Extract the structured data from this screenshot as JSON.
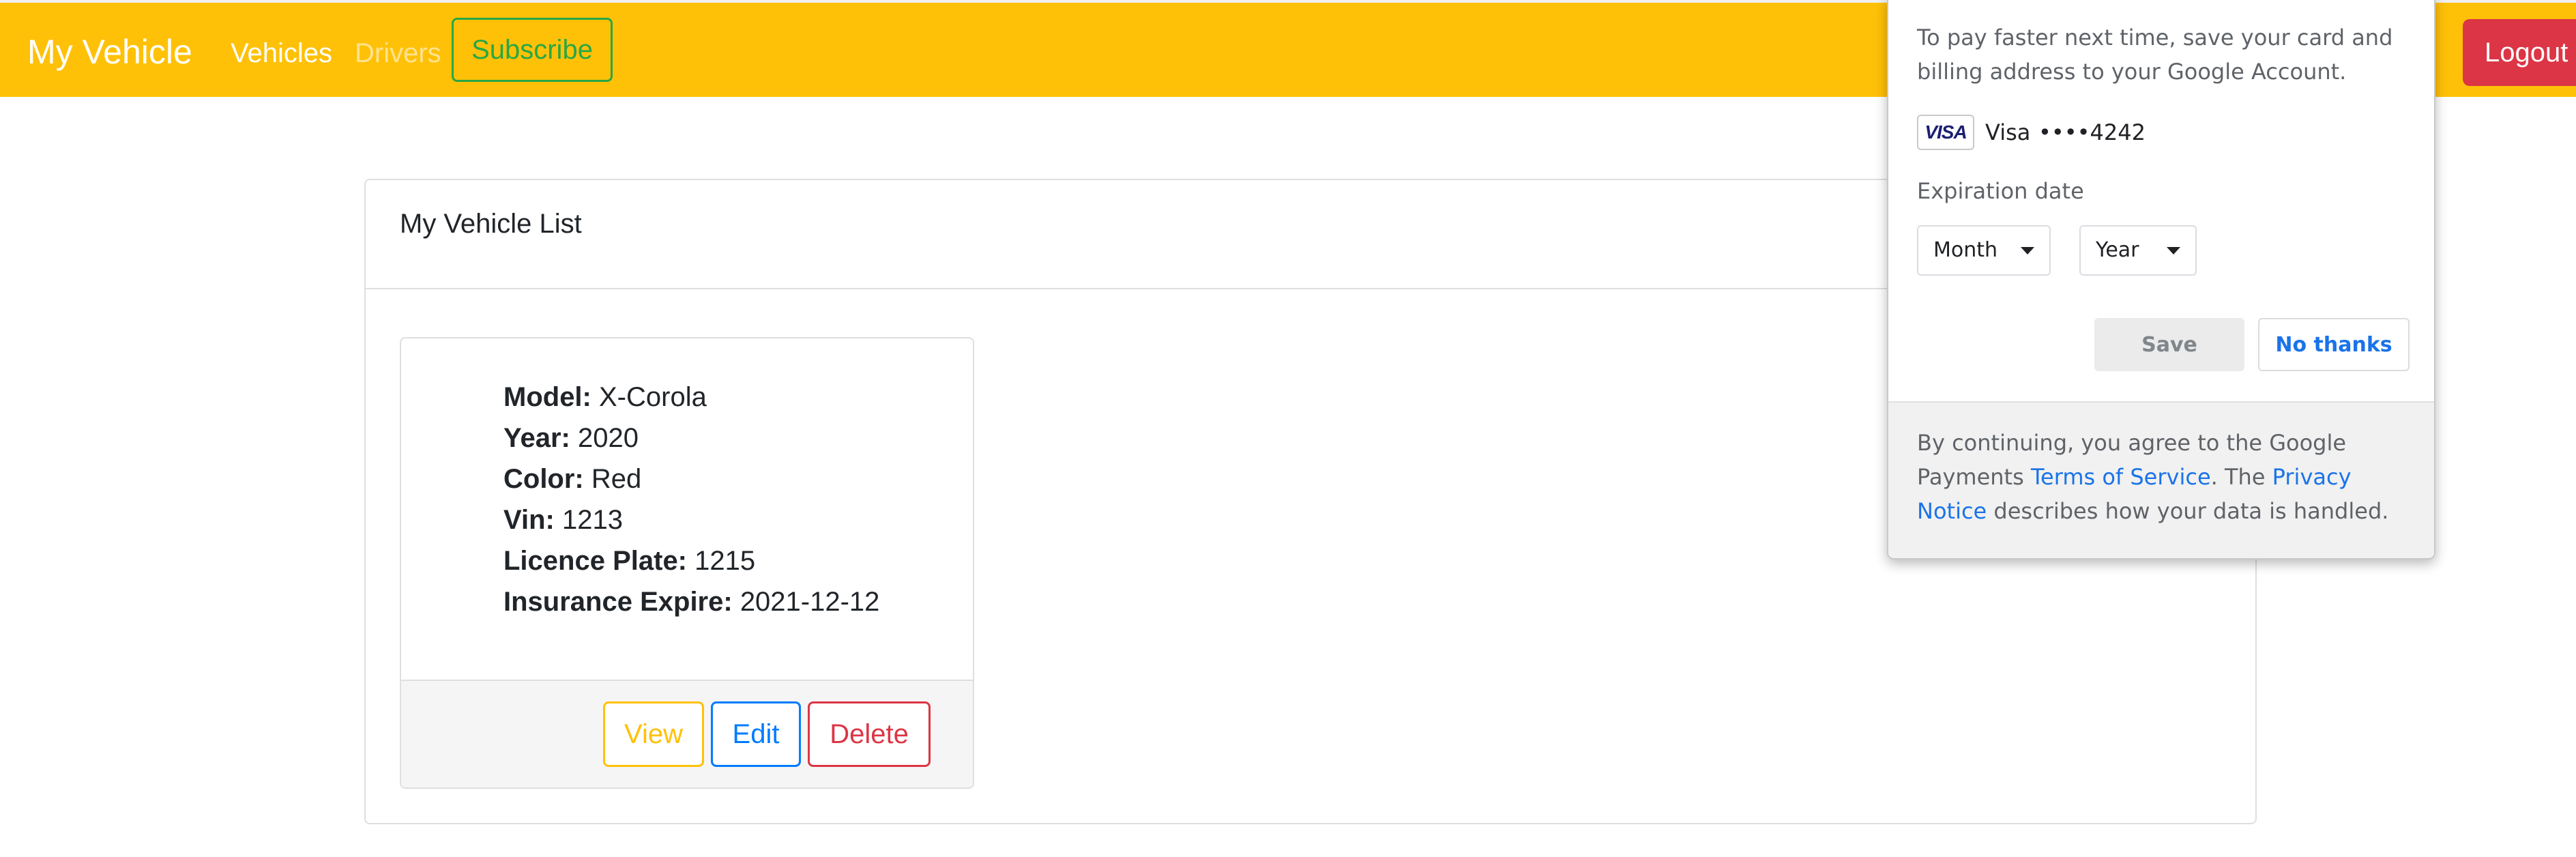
{
  "navbar": {
    "brand": "My Vehicle",
    "links": [
      {
        "label": "Vehicles",
        "active": true
      },
      {
        "label": "Drivers",
        "active": false
      }
    ],
    "subscribe_label": "Subscribe",
    "logout_label": "Logout",
    "background_color": "#ffc107"
  },
  "vehicle_list": {
    "title": "My Vehicle List",
    "vehicles": [
      {
        "details": [
          {
            "label": "Model:",
            "value": "X-Corola"
          },
          {
            "label": "Year:",
            "value": "2020"
          },
          {
            "label": "Color:",
            "value": "Red"
          },
          {
            "label": "Vin:",
            "value": "1213"
          },
          {
            "label": "Licence Plate:",
            "value": "1215"
          },
          {
            "label": "Insurance Expire:",
            "value": "2021-12-12"
          }
        ],
        "actions": {
          "view": "View",
          "edit": "Edit",
          "delete": "Delete"
        }
      }
    ]
  },
  "save_card_popup": {
    "intro": "To pay faster next time, save your card and billing address to your Google Account.",
    "card": {
      "logo_text": "VISA",
      "name": "Visa",
      "number": "••••4242"
    },
    "expiration_label": "Expiration date",
    "month_select": "Month",
    "year_select": "Year",
    "save_label": "Save",
    "no_thanks_label": "No thanks",
    "legal": {
      "prefix": "By continuing, you agree to the Google Payments ",
      "terms_link": "Terms of Service",
      "middle": ". The ",
      "privacy_link": "Privacy Notice",
      "suffix": " describes how your data is handled."
    }
  }
}
